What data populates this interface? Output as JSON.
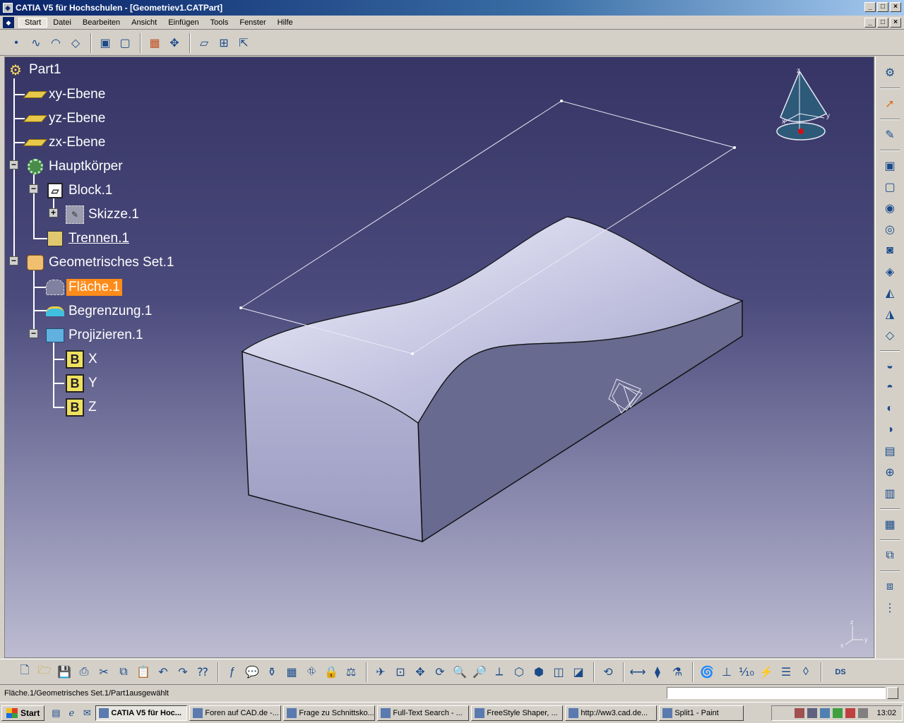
{
  "window": {
    "title": "CATIA V5 für Hochschulen - [Geometriev1.CATPart]",
    "btn_minimize": "_",
    "btn_restore": "□",
    "btn_close": "×"
  },
  "menubar": {
    "items": [
      "Start",
      "Datei",
      "Bearbeiten",
      "Ansicht",
      "Einfügen",
      "Tools",
      "Fenster",
      "Hilfe"
    ]
  },
  "tree": {
    "root": "Part1",
    "xy_plane": "xy-Ebene",
    "yz_plane": "yz-Ebene",
    "zx_plane": "zx-Ebene",
    "main_body": "Hauptkörper",
    "block": "Block.1",
    "sketch": "Skizze.1",
    "split": "Trennen.1",
    "geoset": "Geometrisches Set.1",
    "surface": "Fläche.1",
    "boundary": "Begrenzung.1",
    "project": "Projizieren.1",
    "x": "X",
    "y": "Y",
    "z": "Z"
  },
  "compass": {
    "x": "x",
    "y": "y",
    "z": "z"
  },
  "axis_triad": {
    "x": "x",
    "y": "y",
    "z": "z"
  },
  "status": {
    "text": "Fläche.1/Geometrisches Set.1/Part1ausgewählt"
  },
  "taskbar": {
    "start": "Start",
    "tasks": [
      "CATIA V5 für Hoc...",
      "Foren auf CAD.de -...",
      "Frage zu Schnittsko...",
      "Full-Text Search - ...",
      "FreeStyle Shaper, ...",
      "http://ww3.cad.de...",
      "Split1 - Paint"
    ],
    "clock": "13:02"
  },
  "colors": {
    "selection": "#ff8c1a",
    "title_gradient_start": "#0a246a",
    "viewport_top": "#363565",
    "viewport_bottom": "#bdbcd2"
  }
}
